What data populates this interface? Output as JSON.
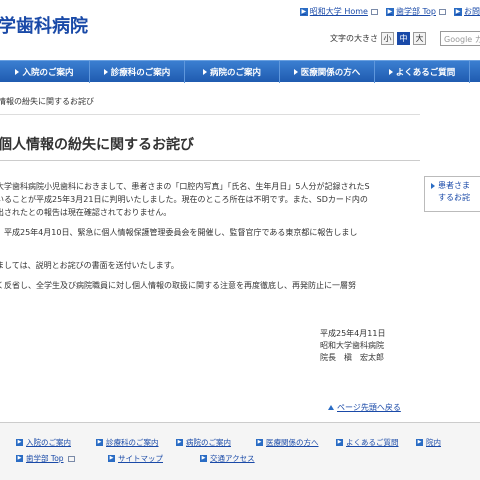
{
  "header": {
    "logo_text": "学歯科病院",
    "top_links": [
      {
        "label": "昭和大学 Home"
      },
      {
        "label": "歯学部 Top"
      },
      {
        "label": "お問"
      }
    ],
    "font_size": {
      "label": "文字の大きさ",
      "options": [
        "小",
        "中",
        "大"
      ],
      "selected": "中"
    },
    "search_placeholder": "Google カス"
  },
  "nav": {
    "items": [
      {
        "label": "入院のご案内"
      },
      {
        "label": "診療科のご案内"
      },
      {
        "label": "病院のご案内"
      },
      {
        "label": "医療関係の方へ"
      },
      {
        "label": "よくあるご質問"
      }
    ]
  },
  "breadcrumb": "情報の紛失に関するお詫び",
  "page_title": "個人情報の紛失に関するお詫び",
  "body": {
    "paragraphs": [
      [
        "大学歯科病院小児歯科におきまして、患者さまの「口腔内写真」「氏名、生年月日」5人分が記録されたS",
        "いることが平成25年3月21日に判明いたしました。現在のところ所在は不明です。また、SDカード内の",
        "出されたとの報告は現在確認されておりません。"
      ],
      [
        "、平成25年4月10日、緊急に個人情報保護管理委員会を開催し、監督官庁である東京都に報告しまし",
        "。"
      ],
      [
        "ましては、説明とお詫びの書面を送付いたします。"
      ],
      [
        "く反省し、全学生及び病院職員に対し個人情報の取扱に関する注意を再度徹底し、再発防止に一層努"
      ]
    ],
    "signature": {
      "date": "平成25年4月11日",
      "org": "昭和大学歯科病院",
      "director": "院長　槇　宏太郎"
    },
    "to_top": "ページ先頭へ戻る"
  },
  "sidebar": {
    "link_lines": [
      "患者さま",
      "するお詫"
    ]
  },
  "footer": {
    "row1": [
      {
        "label": "入院のご案内"
      },
      {
        "label": "診療科のご案内"
      },
      {
        "label": "病院のご案内"
      },
      {
        "label": "医療関係の方へ"
      },
      {
        "label": "よくあるご質問"
      },
      {
        "label": "院内"
      }
    ],
    "row2": [
      {
        "label": "歯学部 Top"
      },
      {
        "label": "サイトマップ"
      },
      {
        "label": "交通アクセス"
      }
    ]
  },
  "colors": {
    "brand": "#1a4aa8",
    "nav_bg": "#2a6cc4",
    "link": "#1a4aa8"
  }
}
